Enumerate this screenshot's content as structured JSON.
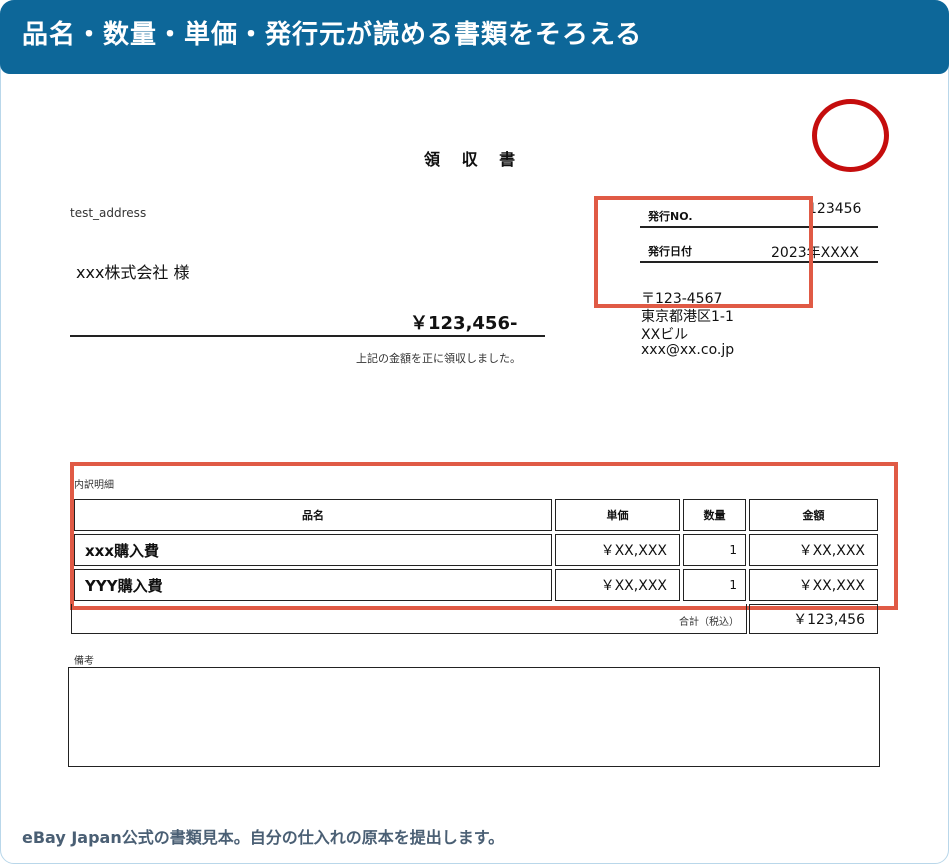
{
  "header": {
    "title": "品名・数量・単価・発行元が読める書類をそろえる"
  },
  "receipt": {
    "title": "領 収 書",
    "address_label": "test_address",
    "recipient": "xxx株式会社   様",
    "amount": "￥123,456-",
    "received_note": "上記の金額を正に領収しました。",
    "issue_no_label": "発行NO.",
    "issue_no_value": "123456",
    "issue_date_label": "発行日付",
    "issue_date_value": "2023年XXXX",
    "issuer": {
      "postal": "〒123-4567",
      "address": "東京都港区1-1",
      "building": "XXビル",
      "email": "xxx@xx.co.jp"
    },
    "details_label": "内訳明細",
    "table": {
      "headers": [
        "品名",
        "単価",
        "数量",
        "金額"
      ],
      "rows": [
        {
          "name": "xxx購入費",
          "unit_price": "￥XX,XXX",
          "qty": "1",
          "amount": "￥XX,XXX"
        },
        {
          "name": "YYY購入費",
          "unit_price": "￥XX,XXX",
          "qty": "1",
          "amount": "￥XX,XXX"
        }
      ],
      "total_label": "合計（税込）",
      "total_value": "￥123,456"
    },
    "remarks_label": "備考"
  },
  "footer": {
    "note": "eBay Japan公式の書類見本。自分の仕入れの原本を提出します。"
  },
  "colors": {
    "header_bg": "#0d6799",
    "highlight": "#e05a45",
    "stamp": "#c50d0d"
  }
}
